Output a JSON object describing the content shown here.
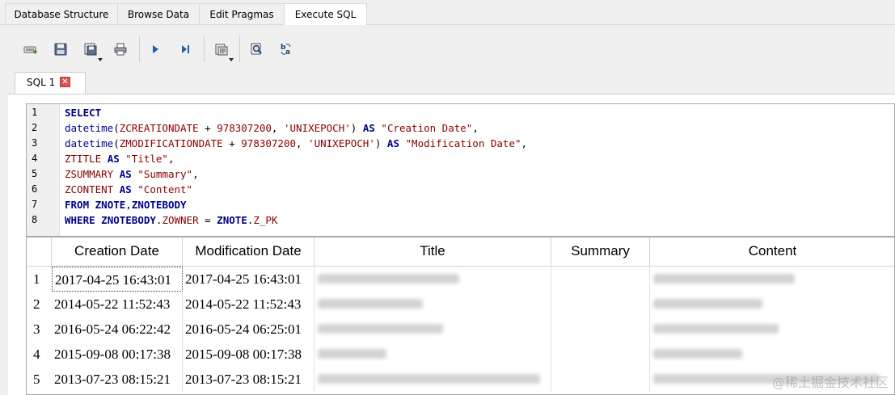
{
  "tabs": [
    {
      "label": "Database Structure",
      "active": false
    },
    {
      "label": "Browse Data",
      "active": false
    },
    {
      "label": "Edit Pragmas",
      "active": false
    },
    {
      "label": "Execute SQL",
      "active": true
    }
  ],
  "toolbar_icons": [
    "open-tab-icon",
    "save-icon",
    "save-results-icon",
    "print-icon",
    "execute-all-icon",
    "execute-line-icon",
    "export-icon",
    "find-icon",
    "replace-icon"
  ],
  "sql_tab": {
    "label": "SQL 1",
    "close_symbol": "✕"
  },
  "editor": {
    "line_numbers": [
      "1",
      "2",
      "3",
      "4",
      "5",
      "6",
      "7",
      "8"
    ],
    "lines": [
      "SELECT",
      "datetime(ZCREATIONDATE + 978307200, 'UNIXEPOCH') AS \"Creation Date\",",
      "datetime(ZMODIFICATIONDATE + 978307200, 'UNIXEPOCH') AS \"Modification Date\",",
      "ZTITLE AS \"Title\",",
      "ZSUMMARY AS \"Summary\",",
      "ZCONTENT AS \"Content\"",
      "FROM ZNOTE,ZNOTEBODY",
      "WHERE ZNOTEBODY.ZOWNER = ZNOTE.Z_PK"
    ]
  },
  "results": {
    "columns": [
      "Creation Date",
      "Modification Date",
      "Title",
      "Summary",
      "Content"
    ],
    "rows": [
      {
        "num": "1",
        "created": "2017-04-25 16:43:01",
        "modified": "2017-04-25 16:43:01"
      },
      {
        "num": "2",
        "created": "2014-05-22 11:52:43",
        "modified": "2014-05-22 11:52:43"
      },
      {
        "num": "3",
        "created": "2016-05-24 06:22:42",
        "modified": "2016-05-24 06:25:01"
      },
      {
        "num": "4",
        "created": "2015-09-08 00:17:38",
        "modified": "2015-09-08 00:17:38"
      },
      {
        "num": "5",
        "created": "2013-07-23 08:15:21",
        "modified": "2013-07-23 08:15:21"
      }
    ]
  },
  "watermark": "@稀土掘金技术社区"
}
